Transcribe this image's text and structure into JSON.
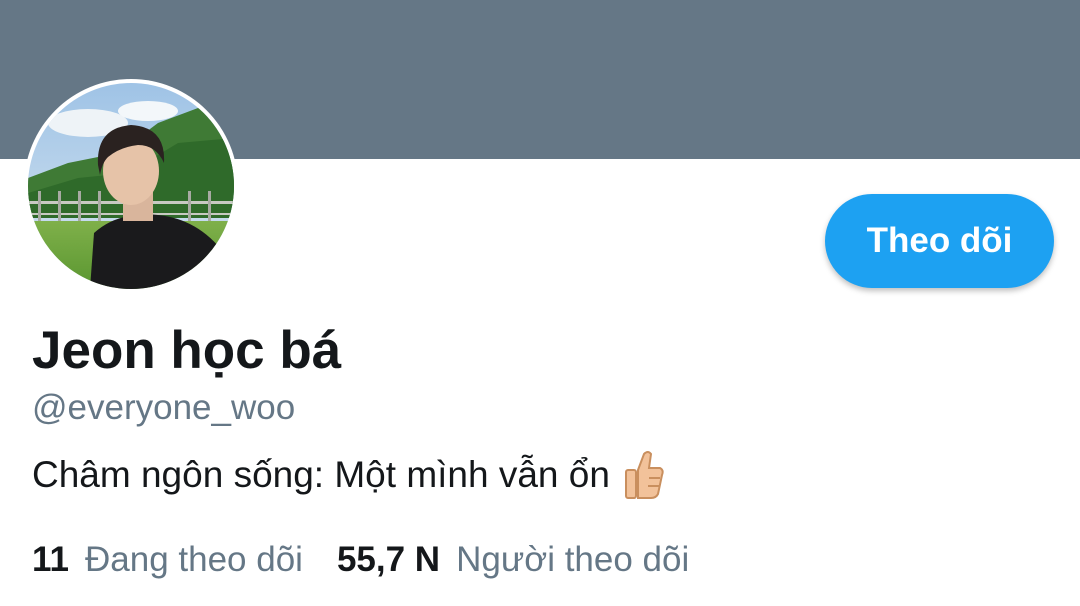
{
  "profile": {
    "banner_color": "#657786",
    "avatar_icon": "profile-photo",
    "follow_label": "Theo dõi",
    "display_name": "Jeon học bá",
    "handle": "@everyone_woo",
    "bio_text": "Châm ngôn sống: Một mình vẫn ổn",
    "bio_emoji": "thumbs-up-icon",
    "accent_color": "#1da1f2"
  },
  "stats": {
    "following_count": "11",
    "following_label": "Đang theo dõi",
    "followers_count": "55,7 N",
    "followers_label": "Người theo dõi"
  }
}
